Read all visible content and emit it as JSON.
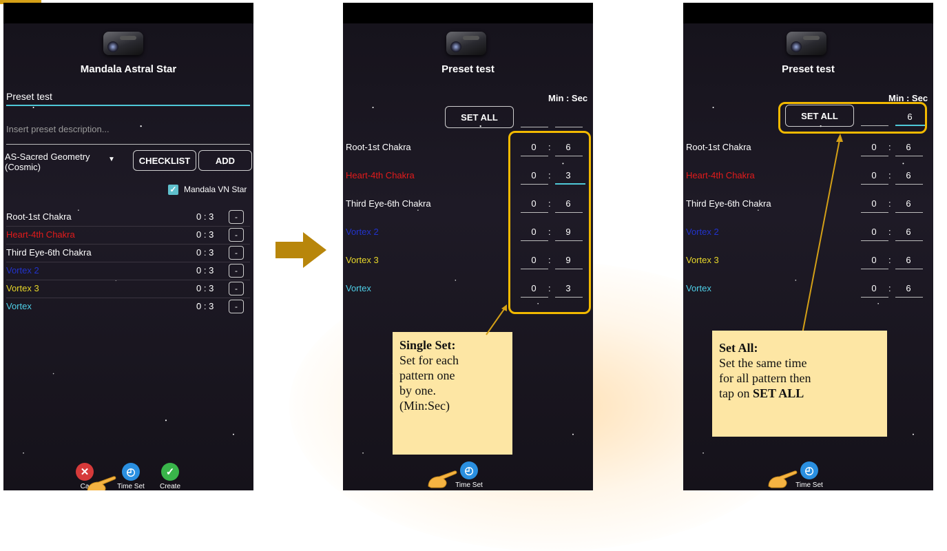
{
  "colors": {
    "accent": "#4fc8d8",
    "highlight": "#f2b900",
    "note_bg": "#fde6a4",
    "heart": "#e31b1b",
    "vortex2": "#2233cc",
    "vortex3": "#e8d82a",
    "vortex": "#4fd0e8"
  },
  "screen1": {
    "title": "Mandala Astral Star",
    "preset_name": "Preset test",
    "description_placeholder": "Insert preset description...",
    "dropdown_line1": "AS-Sacred Geometry",
    "dropdown_line2": "(Cosmic)",
    "checklist_label": "CHECKLIST",
    "add_label": "ADD",
    "checkbox_label": "Mandala VN Star",
    "patterns": [
      {
        "name": "Root-1st Chakra",
        "time": "0 : 3"
      },
      {
        "name": "Heart-4th Chakra",
        "time": "0 : 3"
      },
      {
        "name": "Third Eye-6th Chakra",
        "time": "0 : 3"
      },
      {
        "name": "Vortex 2",
        "time": "0 : 3"
      },
      {
        "name": "Vortex 3",
        "time": "0 : 3"
      },
      {
        "name": "Vortex",
        "time": "0 : 3"
      }
    ],
    "remove_label": "-",
    "nav": {
      "cancel": "Cancel",
      "cancel_visible": "Ca",
      "timeset": "Time Set",
      "create": "Create"
    }
  },
  "screen2": {
    "title": "Preset test",
    "minsec_label": "Min : Sec",
    "setall_label": "SET ALL",
    "patterns": [
      {
        "name": "Root-1st Chakra",
        "min": "0",
        "sec": "6"
      },
      {
        "name": "Heart-4th Chakra",
        "min": "0",
        "sec": "3"
      },
      {
        "name": "Third Eye-6th Chakra",
        "min": "0",
        "sec": "6"
      },
      {
        "name": "Vortex 2",
        "min": "0",
        "sec": "9"
      },
      {
        "name": "Vortex 3",
        "min": "0",
        "sec": "9"
      },
      {
        "name": "Vortex",
        "min": "0",
        "sec": "3"
      }
    ],
    "note_title": "Single Set:",
    "note_line1": "Set for each",
    "note_line2": "pattern one",
    "note_line3": "by one.",
    "note_line4": "(Min:Sec)",
    "nav_timeset": "Time Set"
  },
  "screen3": {
    "title": "Preset test",
    "minsec_label": "Min : Sec",
    "setall_label": "SET ALL",
    "setall_sec": "6",
    "patterns": [
      {
        "name": "Root-1st Chakra",
        "min": "0",
        "sec": "6"
      },
      {
        "name": "Heart-4th Chakra",
        "min": "0",
        "sec": "6"
      },
      {
        "name": "Third Eye-6th Chakra",
        "min": "0",
        "sec": "6"
      },
      {
        "name": "Vortex 2",
        "min": "0",
        "sec": "6"
      },
      {
        "name": "Vortex 3",
        "min": "0",
        "sec": "6"
      },
      {
        "name": "Vortex",
        "min": "0",
        "sec": "6"
      }
    ],
    "note_title": "Set All:",
    "note_line1": "Set the same time",
    "note_line2": "for all pattern then",
    "note_line3": "tap on ",
    "note_bold": "SET ALL",
    "nav_timeset": "Time Set"
  }
}
